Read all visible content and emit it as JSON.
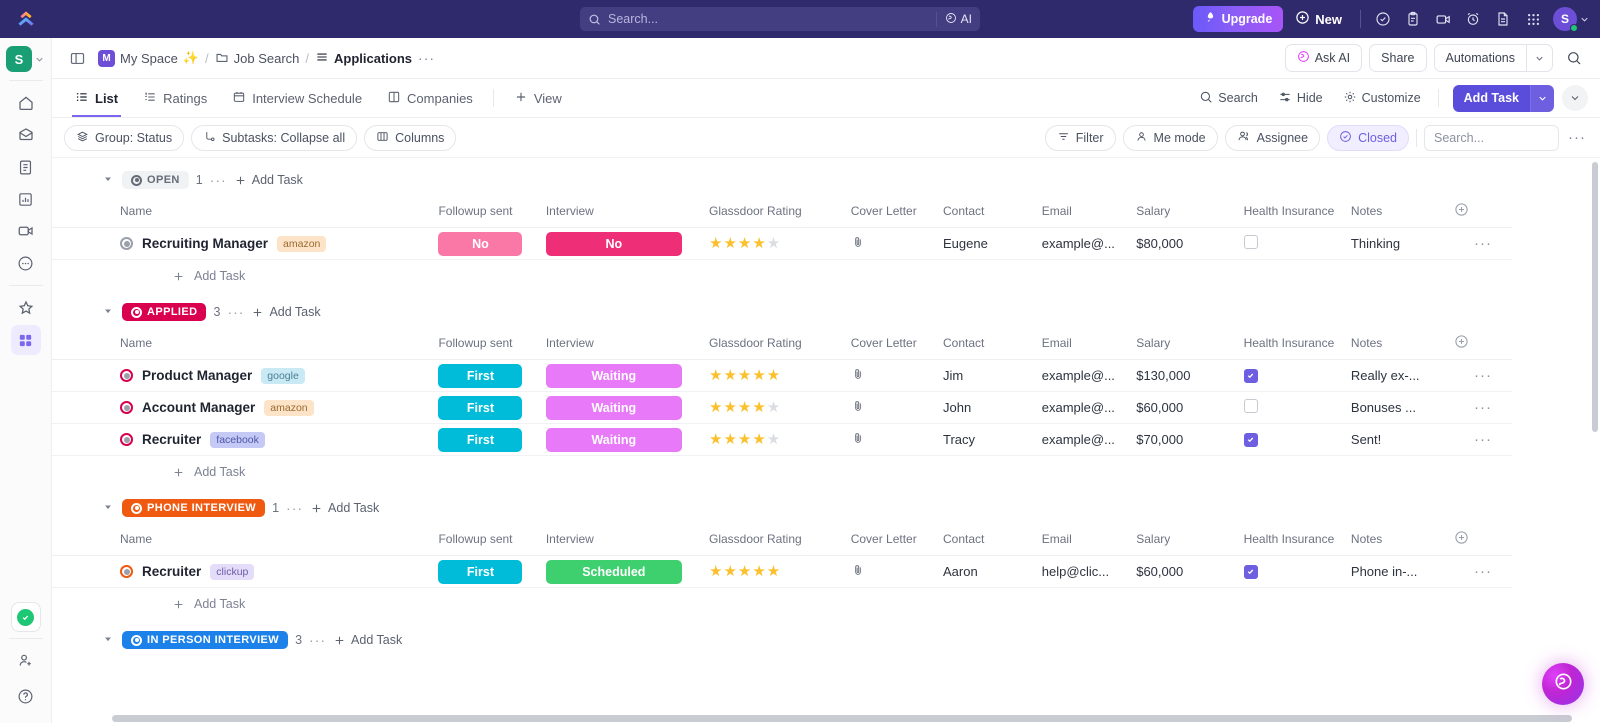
{
  "topbar": {
    "logo_icon": "clickup-logo-icon",
    "search": {
      "placeholder": "Search...",
      "icon": "search-icon"
    },
    "ai_label": "AI",
    "ai_icon": "ai-sparkle-icon",
    "upgrade_label": "Upgrade",
    "upgrade_icon": "rocket-icon",
    "new_label": "New",
    "new_icon": "plus-circle-icon",
    "icons": [
      {
        "name": "check-circle-icon"
      },
      {
        "name": "clipboard-icon"
      },
      {
        "name": "video-clip-icon"
      },
      {
        "name": "alarm-clock-icon"
      },
      {
        "name": "document-icon"
      },
      {
        "name": "apps-grid-icon"
      }
    ],
    "avatar_initial": "S",
    "avatar_color": "#6c4fd6"
  },
  "rail": {
    "space_initial": "S",
    "space_color": "#1a9e73",
    "items": [
      {
        "name": "home-icon",
        "label": "Home",
        "active": false
      },
      {
        "name": "inbox-icon",
        "label": "Inbox",
        "active": false
      },
      {
        "name": "docs-icon",
        "label": "Docs",
        "active": false
      },
      {
        "name": "dashboards-icon",
        "label": "Dashboards",
        "active": false
      },
      {
        "name": "clips-icon",
        "label": "Clips",
        "active": false
      },
      {
        "name": "more-icon",
        "label": "More",
        "active": false
      }
    ],
    "items2": [
      {
        "name": "star-icon",
        "label": "Favorites",
        "active": false
      },
      {
        "name": "apps-grid-icon",
        "label": "Apps",
        "active": true
      }
    ],
    "bottom": [
      {
        "name": "task-check-icon",
        "label": "Tasks"
      },
      {
        "name": "invite-user-icon",
        "label": "Invite"
      },
      {
        "name": "help-icon",
        "label": "Help"
      }
    ]
  },
  "breadcrumb": {
    "panel_icon": "toggle-sidebar-icon",
    "space_badge": "M",
    "space_name": "My Space",
    "space_emoji": "✨",
    "folder_name": "Job Search",
    "folder_icon": "folder-icon",
    "list_name": "Applications",
    "list_icon": "list-icon",
    "overflow": "···",
    "ask_ai_label": "Ask AI",
    "ask_ai_icon": "ai-sparkle-icon",
    "share_label": "Share",
    "automations_label": "Automations",
    "search_icon": "search-icon"
  },
  "views": {
    "tabs": [
      {
        "label": "List",
        "icon": "list-view-icon",
        "active": true
      },
      {
        "label": "Ratings",
        "icon": "list-ordered-icon",
        "active": false
      },
      {
        "label": "Interview Schedule",
        "icon": "calendar-icon",
        "active": false
      },
      {
        "label": "Companies",
        "icon": "board-icon",
        "active": false
      }
    ],
    "add_view_label": "View",
    "add_view_icon": "plus-icon",
    "right_buttons": [
      {
        "label": "Search",
        "icon": "search-icon"
      },
      {
        "label": "Hide",
        "icon": "sliders-icon"
      },
      {
        "label": "Customize",
        "icon": "gear-icon"
      }
    ],
    "add_task_label": "Add Task",
    "add_task_color": "#5b4ddb"
  },
  "filters": {
    "left_pills": [
      {
        "label": "Group: Status",
        "icon": "layers-icon"
      },
      {
        "label": "Subtasks: Collapse all",
        "icon": "subtask-icon"
      },
      {
        "label": "Columns",
        "icon": "columns-icon"
      }
    ],
    "right_pills": [
      {
        "label": "Filter",
        "icon": "filter-icon",
        "active": false
      },
      {
        "label": "Me mode",
        "icon": "person-icon",
        "active": false
      },
      {
        "label": "Assignee",
        "icon": "people-icon",
        "active": false
      },
      {
        "label": "Closed",
        "icon": "check-circle-icon",
        "active": true
      }
    ],
    "search_placeholder": "Search...",
    "overflow": "···"
  },
  "table": {
    "columns": [
      "Name",
      "Followup sent",
      "Interview",
      "Glassdoor Rating",
      "Cover Letter",
      "Contact",
      "Email",
      "Salary",
      "Health Insurance",
      "Notes"
    ],
    "add_task_label": "Add Task",
    "add_column_icon": "plus-circle-icon",
    "row_menu_icon": "ellipsis-icon",
    "attachment_icon": "paperclip-icon"
  },
  "groups": [
    {
      "status": "OPEN",
      "chip_bg": "#f1f2f4",
      "chip_fg": "#656b78",
      "count": "1",
      "add_task_label": "Add Task",
      "rows": [
        {
          "name": "Recruiting Manager",
          "tag": "amazon",
          "tag_bg": "#fde4c8",
          "tag_fg": "#9a6a2e",
          "ring_color": "#9aa0ab",
          "followup": {
            "label": "No",
            "bg": "#f978a6"
          },
          "interview": {
            "label": "No",
            "bg": "#ef2e78"
          },
          "rating": 4,
          "cover_letter": true,
          "contact": "Eugene",
          "email": "example@...",
          "salary": "$80,000",
          "health_insurance": false,
          "notes": "Thinking"
        }
      ]
    },
    {
      "status": "APPLIED",
      "chip_bg": "#d8004f",
      "chip_fg": "#ffffff",
      "count": "3",
      "add_task_label": "Add Task",
      "rows": [
        {
          "name": "Product Manager",
          "tag": "google",
          "tag_bg": "#c9e9f5",
          "tag_fg": "#4a7f93",
          "ring_color": "#d8004f",
          "followup": {
            "label": "First",
            "bg": "#00bcd9"
          },
          "interview": {
            "label": "Waiting",
            "bg": "#e879f9"
          },
          "rating": 5,
          "cover_letter": true,
          "contact": "Jim",
          "email": "example@...",
          "salary": "$130,000",
          "health_insurance": true,
          "notes": "Really ex-..."
        },
        {
          "name": "Account Manager",
          "tag": "amazon",
          "tag_bg": "#fde4c8",
          "tag_fg": "#9a6a2e",
          "ring_color": "#d8004f",
          "followup": {
            "label": "First",
            "bg": "#00bcd9"
          },
          "interview": {
            "label": "Waiting",
            "bg": "#e879f9"
          },
          "rating": 4,
          "cover_letter": true,
          "contact": "John",
          "email": "example@...",
          "salary": "$60,000",
          "health_insurance": false,
          "notes": "Bonuses ..."
        },
        {
          "name": "Recruiter",
          "tag": "facebook",
          "tag_bg": "#c5c9f5",
          "tag_fg": "#4e56a8",
          "ring_color": "#d8004f",
          "followup": {
            "label": "First",
            "bg": "#00bcd9"
          },
          "interview": {
            "label": "Waiting",
            "bg": "#e879f9"
          },
          "rating": 4,
          "cover_letter": true,
          "contact": "Tracy",
          "email": "example@...",
          "salary": "$70,000",
          "health_insurance": true,
          "notes": "Sent!"
        }
      ]
    },
    {
      "status": "PHONE INTERVIEW",
      "chip_bg": "#ef5a10",
      "chip_fg": "#ffffff",
      "count": "1",
      "add_task_label": "Add Task",
      "rows": [
        {
          "name": "Recruiter",
          "tag": "clickup",
          "tag_bg": "#e4ddf9",
          "tag_fg": "#6b5ba8",
          "ring_color": "#ef5a10",
          "followup": {
            "label": "First",
            "bg": "#00bcd9"
          },
          "interview": {
            "label": "Scheduled",
            "bg": "#3ecf6e"
          },
          "rating": 5,
          "cover_letter": true,
          "contact": "Aaron",
          "email": "help@clic...",
          "salary": "$60,000",
          "health_insurance": true,
          "notes": "Phone in-..."
        }
      ]
    },
    {
      "status": "IN PERSON INTERVIEW",
      "chip_bg": "#1c81e8",
      "chip_fg": "#ffffff",
      "count": "3",
      "add_task_label": "Add Task",
      "rows": []
    }
  ],
  "fab": {
    "icon": "ai-sparkle-icon"
  }
}
